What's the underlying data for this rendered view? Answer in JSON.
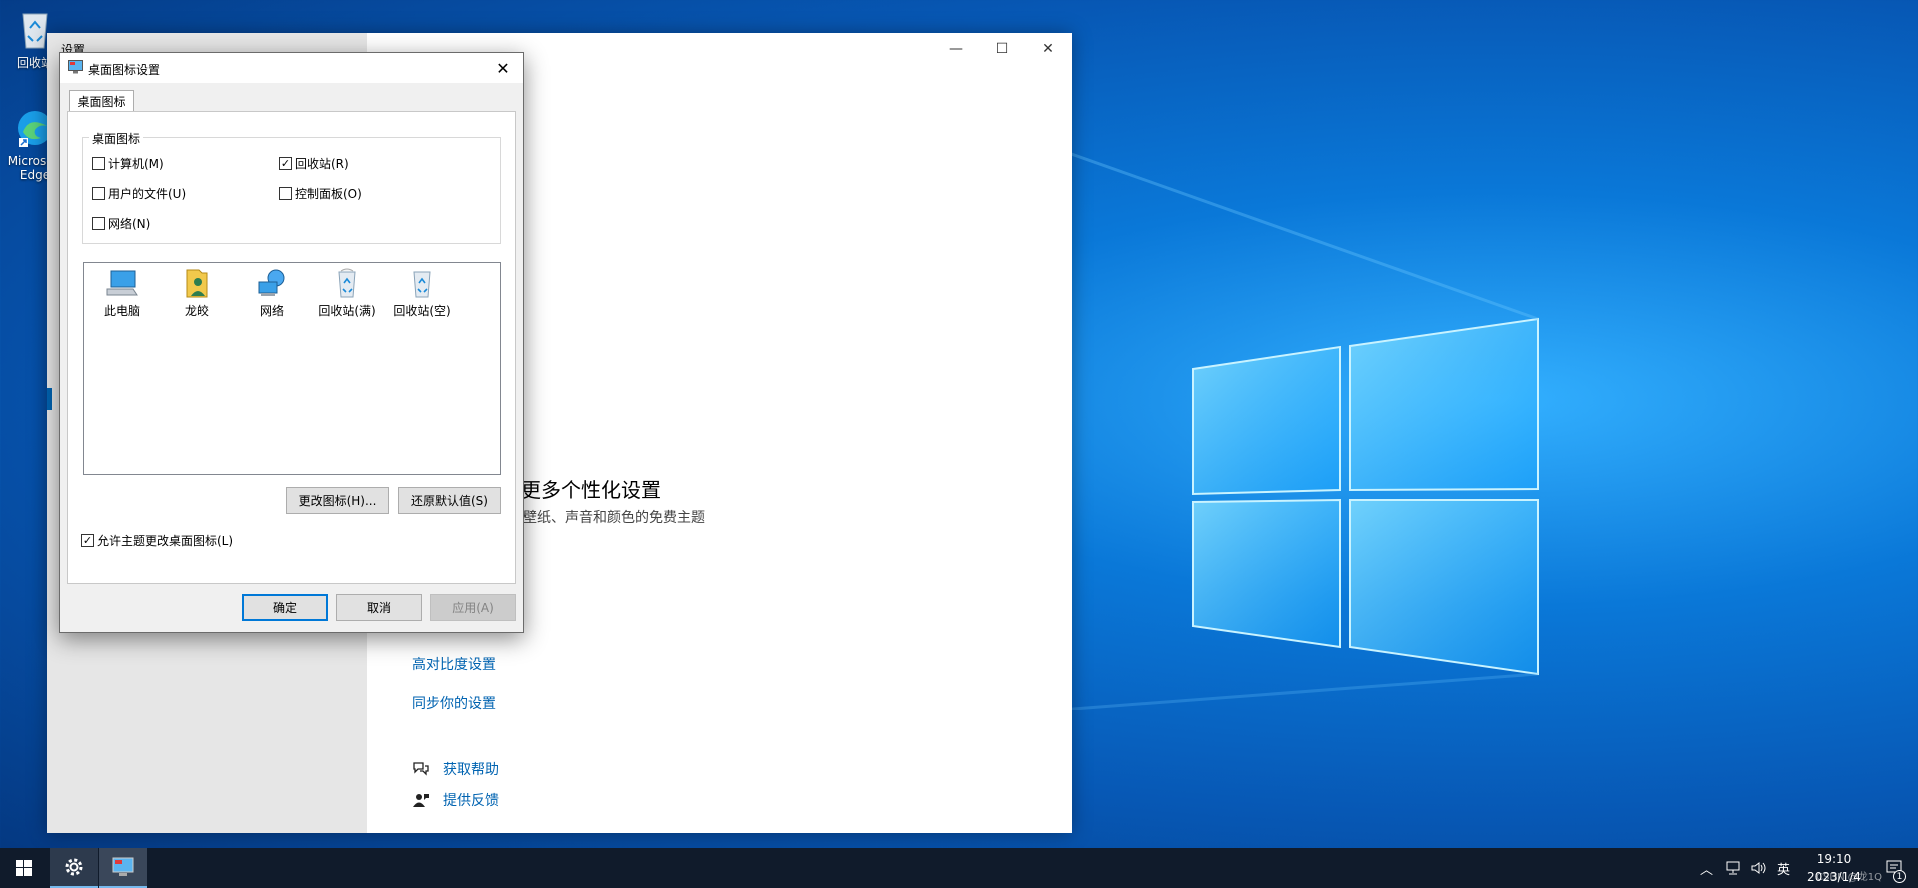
{
  "desktop": {
    "icons": [
      {
        "label": "回收站",
        "icon": "recycle-bin-icon"
      },
      {
        "label": "Microsoft Edge",
        "icon": "edge-icon"
      }
    ],
    "watermark": "CSDN @龙1Q"
  },
  "settings_window": {
    "title": "设置",
    "controls": {
      "minimize": "—",
      "maximize": "☐",
      "close": "✕"
    },
    "content": {
      "heading": "进行更多个性化设置",
      "subtext": "载兼具壁纸、声音和颜色的免费主题",
      "links": [
        "高对比度设置",
        "同步你的设置"
      ],
      "help": [
        {
          "label": "获取帮助",
          "icon": "help-chat-icon"
        },
        {
          "label": "提供反馈",
          "icon": "feedback-icon"
        }
      ]
    }
  },
  "dialog": {
    "title": "桌面图标设置",
    "close": "✕",
    "tab": "桌面图标",
    "group_label": "桌面图标",
    "checkboxes": [
      {
        "label": "计算机(M)",
        "checked": false
      },
      {
        "label": "回收站(R)",
        "checked": true
      },
      {
        "label": "用户的文件(U)",
        "checked": false
      },
      {
        "label": "控制面板(O)",
        "checked": false
      },
      {
        "label": "网络(N)",
        "checked": false
      }
    ],
    "icons": [
      {
        "label": "此电脑",
        "icon": "this-pc-icon"
      },
      {
        "label": "龙皎",
        "icon": "user-folder-icon"
      },
      {
        "label": "网络",
        "icon": "network-icon"
      },
      {
        "label": "回收站(满)",
        "icon": "recycle-bin-full-icon"
      },
      {
        "label": "回收站(空)",
        "icon": "recycle-bin-empty-icon"
      }
    ],
    "change_icon_button": "更改图标(H)...",
    "restore_default_button": "还原默认值(S)",
    "allow_themes": {
      "label": "允许主题更改桌面图标(L)",
      "checked": true
    },
    "ok_button": "确定",
    "cancel_button": "取消",
    "apply_button": "应用(A)"
  },
  "taskbar": {
    "tray": {
      "ime": "英",
      "time": "19:10",
      "date": "2023/1/4",
      "notification_count": "1"
    }
  },
  "colors": {
    "accent": "#0078d7",
    "link": "#0063b1",
    "taskbar": "#101b2b"
  }
}
